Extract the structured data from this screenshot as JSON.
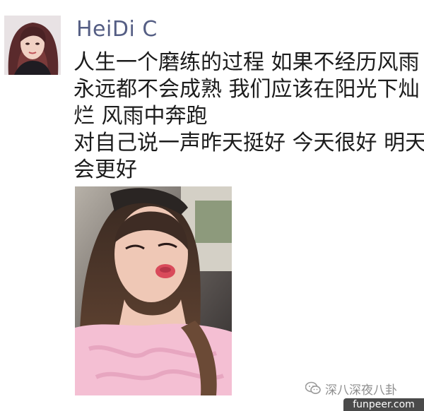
{
  "post": {
    "author": "HeiDi C",
    "message_lines": [
      "人生一个磨练的过程  如果不经历风雨",
      "永远都不会成熟  我们应该在阳光下灿",
      "烂  风雨中奔跑",
      "对自己说一声昨天挺好 今天很好 明天",
      "会更好"
    ],
    "avatar_icon": "user-avatar-photo",
    "photo_icon": "selfie-photo"
  },
  "watermark": {
    "text": "深八深夜八卦",
    "icon": "wechat-icon"
  },
  "site_badge": "funpeer.com",
  "colors": {
    "author_name": "#555e84",
    "message_text": "#1c1c1c",
    "watermark_text": "#8e8e8e",
    "badge_background": "#4a4a4a"
  }
}
